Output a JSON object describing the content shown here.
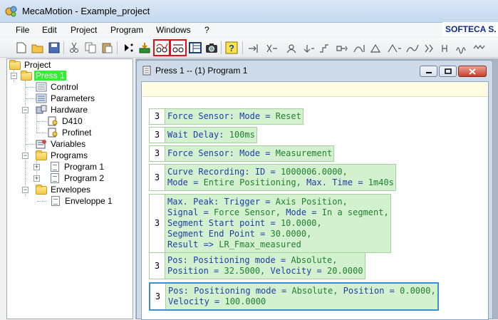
{
  "window": {
    "title": "MecaMotion - Example_project"
  },
  "menu": [
    "File",
    "Edit",
    "Project",
    "Program",
    "Windows",
    "?"
  ],
  "brand": "SOFTECA S.",
  "colors": {
    "accent": "#3b8fd6",
    "highlight_outline": "#e0101a",
    "step_bg": "#d3f1cf",
    "selected_node": "#33ee33"
  },
  "toolbar": {
    "icons": [
      "new-icon",
      "open-icon",
      "save-icon",
      "cut-icon",
      "copy-icon",
      "paste-icon",
      "run-icon",
      "download-icon",
      "curve-recording-icon",
      "curve-view-icon",
      "panel-icon",
      "camera-icon",
      "help-icon",
      "step-icons"
    ]
  },
  "tree": {
    "root": "Project",
    "press": "Press 1",
    "control": "Control",
    "parameters": "Parameters",
    "hardware": "Hardware",
    "d410": "D410",
    "profinet": "Profinet",
    "variables": "Variables",
    "programs": "Programs",
    "program1": "Program 1",
    "program2": "Program 2",
    "envelopes": "Envelopes",
    "envelope1": "Enveloppe 1"
  },
  "editor": {
    "title": "Press 1 -- (1) Program 1",
    "steps": [
      {
        "num": "3",
        "lines": [
          [
            [
              "Force Sensor: Mode = ",
              "k"
            ],
            [
              "Reset",
              "v"
            ]
          ]
        ]
      },
      {
        "num": "3",
        "lines": [
          [
            [
              "Wait Delay: ",
              "k"
            ],
            [
              "100ms",
              "v"
            ]
          ]
        ]
      },
      {
        "num": "3",
        "lines": [
          [
            [
              "Force Sensor: Mode = ",
              "k"
            ],
            [
              "Measurement",
              "v"
            ]
          ]
        ]
      },
      {
        "num": "3",
        "lines": [
          [
            [
              "Curve Recording: ID = ",
              "k"
            ],
            [
              "1000006.0000,",
              "v"
            ]
          ],
          [
            [
              "Mode = ",
              "k"
            ],
            [
              "Entire Positioning, ",
              "v"
            ],
            [
              "Max. Time = ",
              "k"
            ],
            [
              "1m40s",
              "v"
            ]
          ]
        ]
      },
      {
        "num": "3",
        "lines": [
          [
            [
              "Max. Peak: Trigger = ",
              "k"
            ],
            [
              "Axis Position,",
              "v"
            ]
          ],
          [
            [
              "Signal = ",
              "k"
            ],
            [
              "Force Sensor, ",
              "v"
            ],
            [
              "Mode = ",
              "k"
            ],
            [
              "In a segment,",
              "v"
            ]
          ],
          [
            [
              "Segment Start point = ",
              "k"
            ],
            [
              "10.0000,",
              "v"
            ]
          ],
          [
            [
              "Segment End Point = ",
              "k"
            ],
            [
              "30.0000,",
              "v"
            ]
          ],
          [
            [
              "Result => ",
              "k"
            ],
            [
              "LR_Fmax_measured",
              "v"
            ]
          ]
        ]
      },
      {
        "num": "3",
        "lines": [
          [
            [
              "Pos: Positioning mode = ",
              "k"
            ],
            [
              "Absolute,",
              "v"
            ]
          ],
          [
            [
              "Position = ",
              "k"
            ],
            [
              "32.5000, ",
              "v"
            ],
            [
              "Velocity = ",
              "k"
            ],
            [
              "20.0000",
              "v"
            ]
          ]
        ]
      },
      {
        "num": "3",
        "lines": [
          [
            [
              "Pos: Positioning mode = ",
              "k"
            ],
            [
              "Absolute, ",
              "v"
            ],
            [
              "Position = ",
              "k"
            ],
            [
              "0.0000,",
              "v"
            ]
          ],
          [
            [
              "Velocity = ",
              "k"
            ],
            [
              "100.0000",
              "v"
            ]
          ]
        ]
      }
    ]
  }
}
